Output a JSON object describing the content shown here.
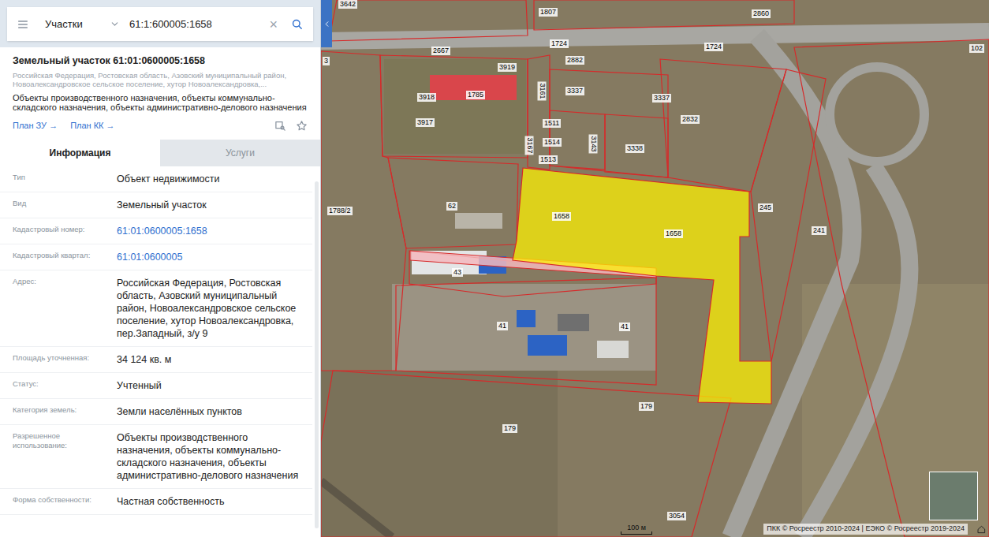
{
  "search": {
    "layer": "Участки",
    "query": "61:1:600005:1658",
    "clear": "×"
  },
  "parcel": {
    "title": "Земельный участок 61:01:0600005:1658",
    "address": "Российская Федерация, Ростовская область, Азовский муниципальный район, Новоалександровское сельское поселение, хутор Новоалександровка,...",
    "purpose": "Объекты производственного назначения, объекты коммунально-складского назначения, объекты административно-делового назначения",
    "links": [
      "План ЗУ →",
      "План КК →"
    ]
  },
  "tabs": [
    {
      "label": "Информация",
      "selected": true
    },
    {
      "label": "Услуги",
      "selected": false
    }
  ],
  "fields": [
    {
      "label": "Тип",
      "value": "Объект недвижимости",
      "kind": "text"
    },
    {
      "label": "Вид",
      "value": "Земельный участок",
      "kind": "text"
    },
    {
      "label": "Кадастровый номер:",
      "value": "61:01:0600005:1658",
      "kind": "link"
    },
    {
      "label": "Кадастровый квартал:",
      "value": "61:01:0600005",
      "kind": "link"
    },
    {
      "label": "Адрес:",
      "value": "Российская Федерация, Ростовская область, Азовский муниципальный район, Новоалександровское сельское поселение, хутор Новоалександровка, пер.Западный, з/у 9",
      "kind": "text"
    },
    {
      "label": "Площадь уточненная:",
      "value": "34 124 кв. м",
      "kind": "text"
    },
    {
      "label": "Статус:",
      "value": "Учтенный",
      "kind": "text"
    },
    {
      "label": "Категория земель:",
      "value": "Земли населённых пунктов",
      "kind": "text"
    },
    {
      "label": "Разрешенное использование:",
      "value": "Объекты производственного назначения, объекты коммунально-складского назначения, объекты административно-делового назначения",
      "kind": "text"
    },
    {
      "label": "Форма собственности:",
      "value": "Частная собственность",
      "kind": "text"
    }
  ],
  "map": {
    "labels": [
      "3642",
      "1807",
      "2860",
      "2667",
      "3919",
      "3918",
      "1785",
      "3161",
      "1724",
      "1724",
      "2882",
      "3337",
      "3337",
      "102",
      "1511",
      "3917",
      "1514",
      "3143",
      "3338",
      "2832",
      "1513",
      "3167",
      "1788/2",
      "62",
      "1658",
      "1658",
      "245",
      "241",
      "43",
      "41",
      "41",
      "179",
      "179",
      "3054",
      "3"
    ],
    "scale": "100 м",
    "attribution": "ПКК © Росреестр 2010-2024 | ЕЭКО © Росреестр 2019-2024"
  }
}
